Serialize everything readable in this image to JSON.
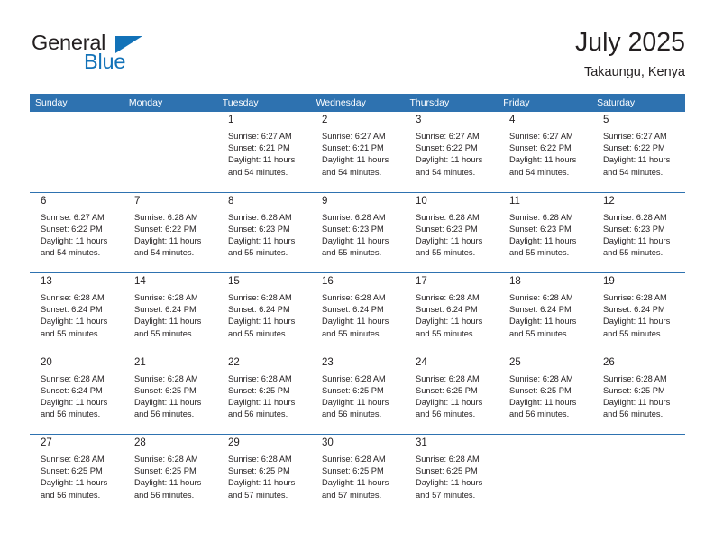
{
  "logo": {
    "word1": "General",
    "word2": "Blue",
    "triangle_color": "#1272b8",
    "text_color": "#231f20"
  },
  "header": {
    "title": "July 2025",
    "subtitle": "Takaungu, Kenya"
  },
  "theme": {
    "header_blue": "#2e72b0",
    "daynum_band": "#f0f0f0",
    "text": "#231f20",
    "separator_blue": "#2e72b0"
  },
  "weekdays": [
    "Sunday",
    "Monday",
    "Tuesday",
    "Wednesday",
    "Thursday",
    "Friday",
    "Saturday"
  ],
  "weeks": [
    [
      {
        "day": "",
        "sunrise": "",
        "sunset": "",
        "daylight1": "",
        "daylight2": ""
      },
      {
        "day": "",
        "sunrise": "",
        "sunset": "",
        "daylight1": "",
        "daylight2": ""
      },
      {
        "day": "1",
        "sunrise": "Sunrise: 6:27 AM",
        "sunset": "Sunset: 6:21 PM",
        "daylight1": "Daylight: 11 hours",
        "daylight2": "and 54 minutes."
      },
      {
        "day": "2",
        "sunrise": "Sunrise: 6:27 AM",
        "sunset": "Sunset: 6:21 PM",
        "daylight1": "Daylight: 11 hours",
        "daylight2": "and 54 minutes."
      },
      {
        "day": "3",
        "sunrise": "Sunrise: 6:27 AM",
        "sunset": "Sunset: 6:22 PM",
        "daylight1": "Daylight: 11 hours",
        "daylight2": "and 54 minutes."
      },
      {
        "day": "4",
        "sunrise": "Sunrise: 6:27 AM",
        "sunset": "Sunset: 6:22 PM",
        "daylight1": "Daylight: 11 hours",
        "daylight2": "and 54 minutes."
      },
      {
        "day": "5",
        "sunrise": "Sunrise: 6:27 AM",
        "sunset": "Sunset: 6:22 PM",
        "daylight1": "Daylight: 11 hours",
        "daylight2": "and 54 minutes."
      }
    ],
    [
      {
        "day": "6",
        "sunrise": "Sunrise: 6:27 AM",
        "sunset": "Sunset: 6:22 PM",
        "daylight1": "Daylight: 11 hours",
        "daylight2": "and 54 minutes."
      },
      {
        "day": "7",
        "sunrise": "Sunrise: 6:28 AM",
        "sunset": "Sunset: 6:22 PM",
        "daylight1": "Daylight: 11 hours",
        "daylight2": "and 54 minutes."
      },
      {
        "day": "8",
        "sunrise": "Sunrise: 6:28 AM",
        "sunset": "Sunset: 6:23 PM",
        "daylight1": "Daylight: 11 hours",
        "daylight2": "and 55 minutes."
      },
      {
        "day": "9",
        "sunrise": "Sunrise: 6:28 AM",
        "sunset": "Sunset: 6:23 PM",
        "daylight1": "Daylight: 11 hours",
        "daylight2": "and 55 minutes."
      },
      {
        "day": "10",
        "sunrise": "Sunrise: 6:28 AM",
        "sunset": "Sunset: 6:23 PM",
        "daylight1": "Daylight: 11 hours",
        "daylight2": "and 55 minutes."
      },
      {
        "day": "11",
        "sunrise": "Sunrise: 6:28 AM",
        "sunset": "Sunset: 6:23 PM",
        "daylight1": "Daylight: 11 hours",
        "daylight2": "and 55 minutes."
      },
      {
        "day": "12",
        "sunrise": "Sunrise: 6:28 AM",
        "sunset": "Sunset: 6:23 PM",
        "daylight1": "Daylight: 11 hours",
        "daylight2": "and 55 minutes."
      }
    ],
    [
      {
        "day": "13",
        "sunrise": "Sunrise: 6:28 AM",
        "sunset": "Sunset: 6:24 PM",
        "daylight1": "Daylight: 11 hours",
        "daylight2": "and 55 minutes."
      },
      {
        "day": "14",
        "sunrise": "Sunrise: 6:28 AM",
        "sunset": "Sunset: 6:24 PM",
        "daylight1": "Daylight: 11 hours",
        "daylight2": "and 55 minutes."
      },
      {
        "day": "15",
        "sunrise": "Sunrise: 6:28 AM",
        "sunset": "Sunset: 6:24 PM",
        "daylight1": "Daylight: 11 hours",
        "daylight2": "and 55 minutes."
      },
      {
        "day": "16",
        "sunrise": "Sunrise: 6:28 AM",
        "sunset": "Sunset: 6:24 PM",
        "daylight1": "Daylight: 11 hours",
        "daylight2": "and 55 minutes."
      },
      {
        "day": "17",
        "sunrise": "Sunrise: 6:28 AM",
        "sunset": "Sunset: 6:24 PM",
        "daylight1": "Daylight: 11 hours",
        "daylight2": "and 55 minutes."
      },
      {
        "day": "18",
        "sunrise": "Sunrise: 6:28 AM",
        "sunset": "Sunset: 6:24 PM",
        "daylight1": "Daylight: 11 hours",
        "daylight2": "and 55 minutes."
      },
      {
        "day": "19",
        "sunrise": "Sunrise: 6:28 AM",
        "sunset": "Sunset: 6:24 PM",
        "daylight1": "Daylight: 11 hours",
        "daylight2": "and 55 minutes."
      }
    ],
    [
      {
        "day": "20",
        "sunrise": "Sunrise: 6:28 AM",
        "sunset": "Sunset: 6:24 PM",
        "daylight1": "Daylight: 11 hours",
        "daylight2": "and 56 minutes."
      },
      {
        "day": "21",
        "sunrise": "Sunrise: 6:28 AM",
        "sunset": "Sunset: 6:25 PM",
        "daylight1": "Daylight: 11 hours",
        "daylight2": "and 56 minutes."
      },
      {
        "day": "22",
        "sunrise": "Sunrise: 6:28 AM",
        "sunset": "Sunset: 6:25 PM",
        "daylight1": "Daylight: 11 hours",
        "daylight2": "and 56 minutes."
      },
      {
        "day": "23",
        "sunrise": "Sunrise: 6:28 AM",
        "sunset": "Sunset: 6:25 PM",
        "daylight1": "Daylight: 11 hours",
        "daylight2": "and 56 minutes."
      },
      {
        "day": "24",
        "sunrise": "Sunrise: 6:28 AM",
        "sunset": "Sunset: 6:25 PM",
        "daylight1": "Daylight: 11 hours",
        "daylight2": "and 56 minutes."
      },
      {
        "day": "25",
        "sunrise": "Sunrise: 6:28 AM",
        "sunset": "Sunset: 6:25 PM",
        "daylight1": "Daylight: 11 hours",
        "daylight2": "and 56 minutes."
      },
      {
        "day": "26",
        "sunrise": "Sunrise: 6:28 AM",
        "sunset": "Sunset: 6:25 PM",
        "daylight1": "Daylight: 11 hours",
        "daylight2": "and 56 minutes."
      }
    ],
    [
      {
        "day": "27",
        "sunrise": "Sunrise: 6:28 AM",
        "sunset": "Sunset: 6:25 PM",
        "daylight1": "Daylight: 11 hours",
        "daylight2": "and 56 minutes."
      },
      {
        "day": "28",
        "sunrise": "Sunrise: 6:28 AM",
        "sunset": "Sunset: 6:25 PM",
        "daylight1": "Daylight: 11 hours",
        "daylight2": "and 56 minutes."
      },
      {
        "day": "29",
        "sunrise": "Sunrise: 6:28 AM",
        "sunset": "Sunset: 6:25 PM",
        "daylight1": "Daylight: 11 hours",
        "daylight2": "and 57 minutes."
      },
      {
        "day": "30",
        "sunrise": "Sunrise: 6:28 AM",
        "sunset": "Sunset: 6:25 PM",
        "daylight1": "Daylight: 11 hours",
        "daylight2": "and 57 minutes."
      },
      {
        "day": "31",
        "sunrise": "Sunrise: 6:28 AM",
        "sunset": "Sunset: 6:25 PM",
        "daylight1": "Daylight: 11 hours",
        "daylight2": "and 57 minutes."
      },
      {
        "day": "",
        "sunrise": "",
        "sunset": "",
        "daylight1": "",
        "daylight2": ""
      },
      {
        "day": "",
        "sunrise": "",
        "sunset": "",
        "daylight1": "",
        "daylight2": ""
      }
    ]
  ]
}
